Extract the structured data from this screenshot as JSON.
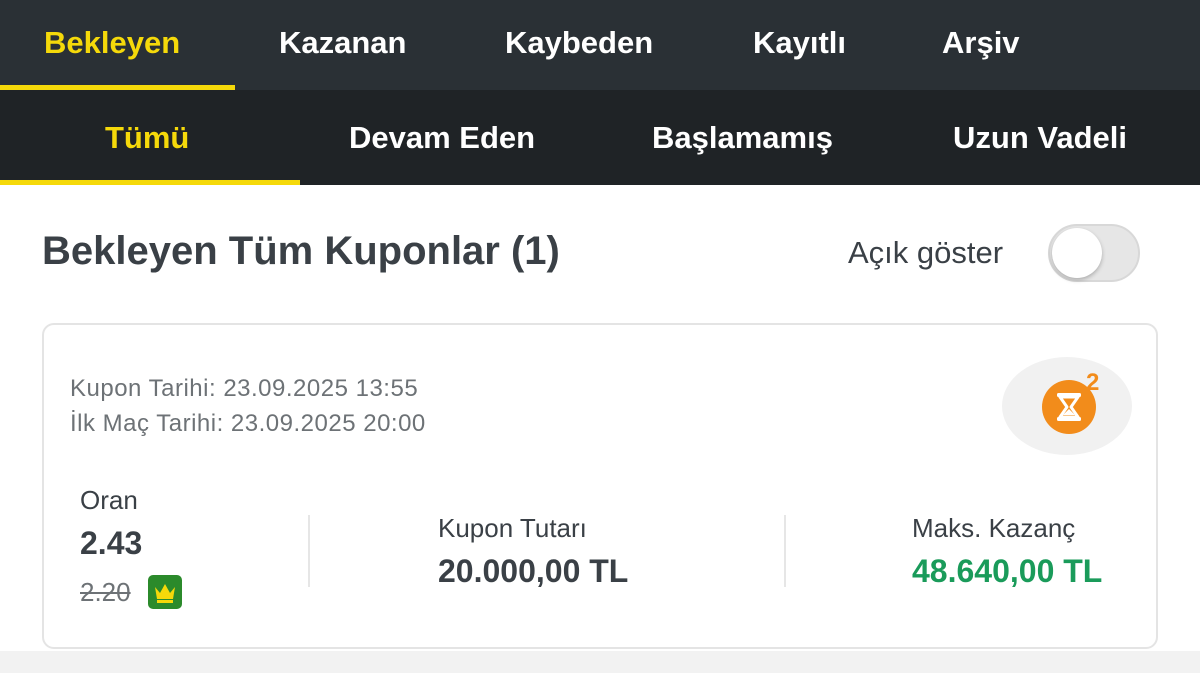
{
  "top_tabs": [
    {
      "label": "Bekleyen",
      "active": true
    },
    {
      "label": "Kazanan",
      "active": false
    },
    {
      "label": "Kaybeden",
      "active": false
    },
    {
      "label": "Kayıtlı",
      "active": false
    },
    {
      "label": "Arşiv",
      "active": false
    }
  ],
  "sub_tabs": [
    {
      "label": "Tümü",
      "active": true
    },
    {
      "label": "Devam Eden",
      "active": false
    },
    {
      "label": "Başlamamış",
      "active": false
    },
    {
      "label": "Uzun Vadeli",
      "active": false
    }
  ],
  "page": {
    "title": "Bekleyen Tüm Kuponlar (1)",
    "toggle_label": "Açık göster",
    "toggle_on": false
  },
  "coupon": {
    "kupon_tarihi": "Kupon Tarihi: 23.09.2025 13:55",
    "ilk_mac_tarihi": "İlk Maç Tarihi: 23.09.2025 20:00",
    "status_icon": "hourglass-icon",
    "status_count": "2",
    "oran_label": "Oran",
    "oran_value": "2.43",
    "oran_old": "2.20",
    "boost_icon": "crown-icon",
    "tutar_label": "Kupon Tutarı",
    "tutar_value": "20.000,00 TL",
    "kazanc_label": "Maks. Kazanç",
    "kazanc_value": "48.640,00 TL"
  },
  "colors": {
    "accent": "#f5d90a",
    "top_bar": "#2a3035",
    "sub_bar": "#1f2326",
    "win_green": "#1a9b5a",
    "status_orange": "#f28c1b",
    "boost_green": "#2b8a2b"
  }
}
